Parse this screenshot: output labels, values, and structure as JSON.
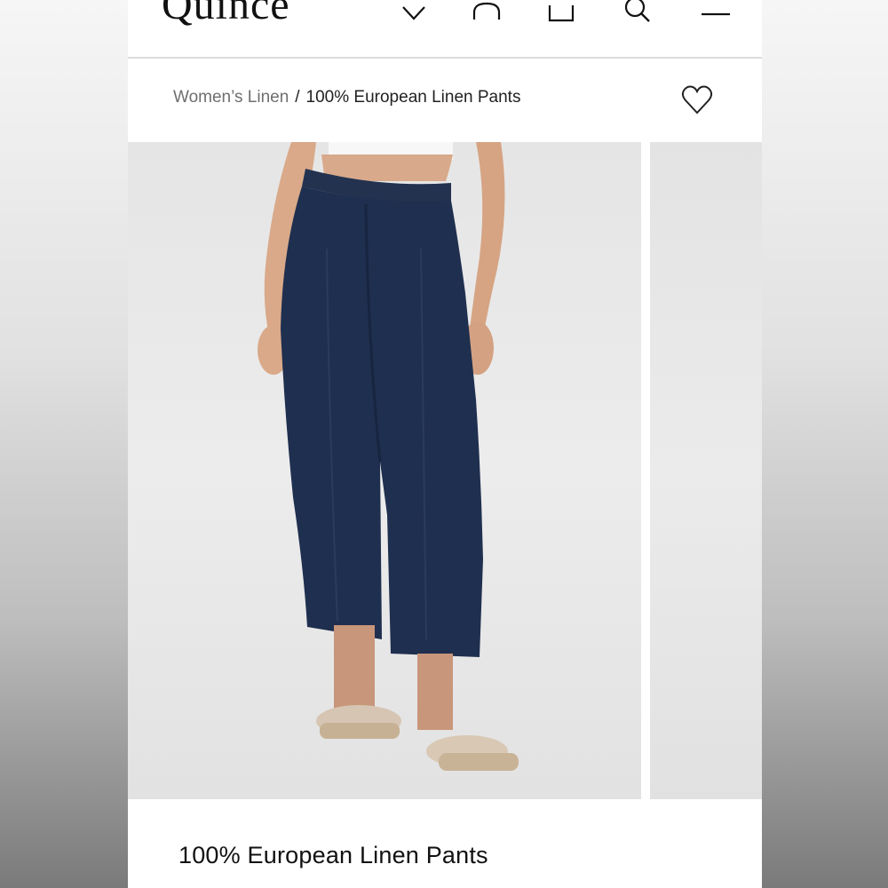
{
  "header": {
    "brand": "Quince",
    "icons": [
      "chevron-down-icon",
      "account-icon",
      "bag-icon",
      "search-icon",
      "menu-icon"
    ]
  },
  "breadcrumb": {
    "parent": "Women’s Linen",
    "separator": "/",
    "current": "100% European Linen Pants"
  },
  "product": {
    "title": "100% European Linen Pants",
    "wishlist_icon": "heart-icon",
    "image_description_colors": {
      "pants": "#1f2f4f",
      "background": "#e8e8e8",
      "sandals": "#d8c8b4"
    }
  }
}
